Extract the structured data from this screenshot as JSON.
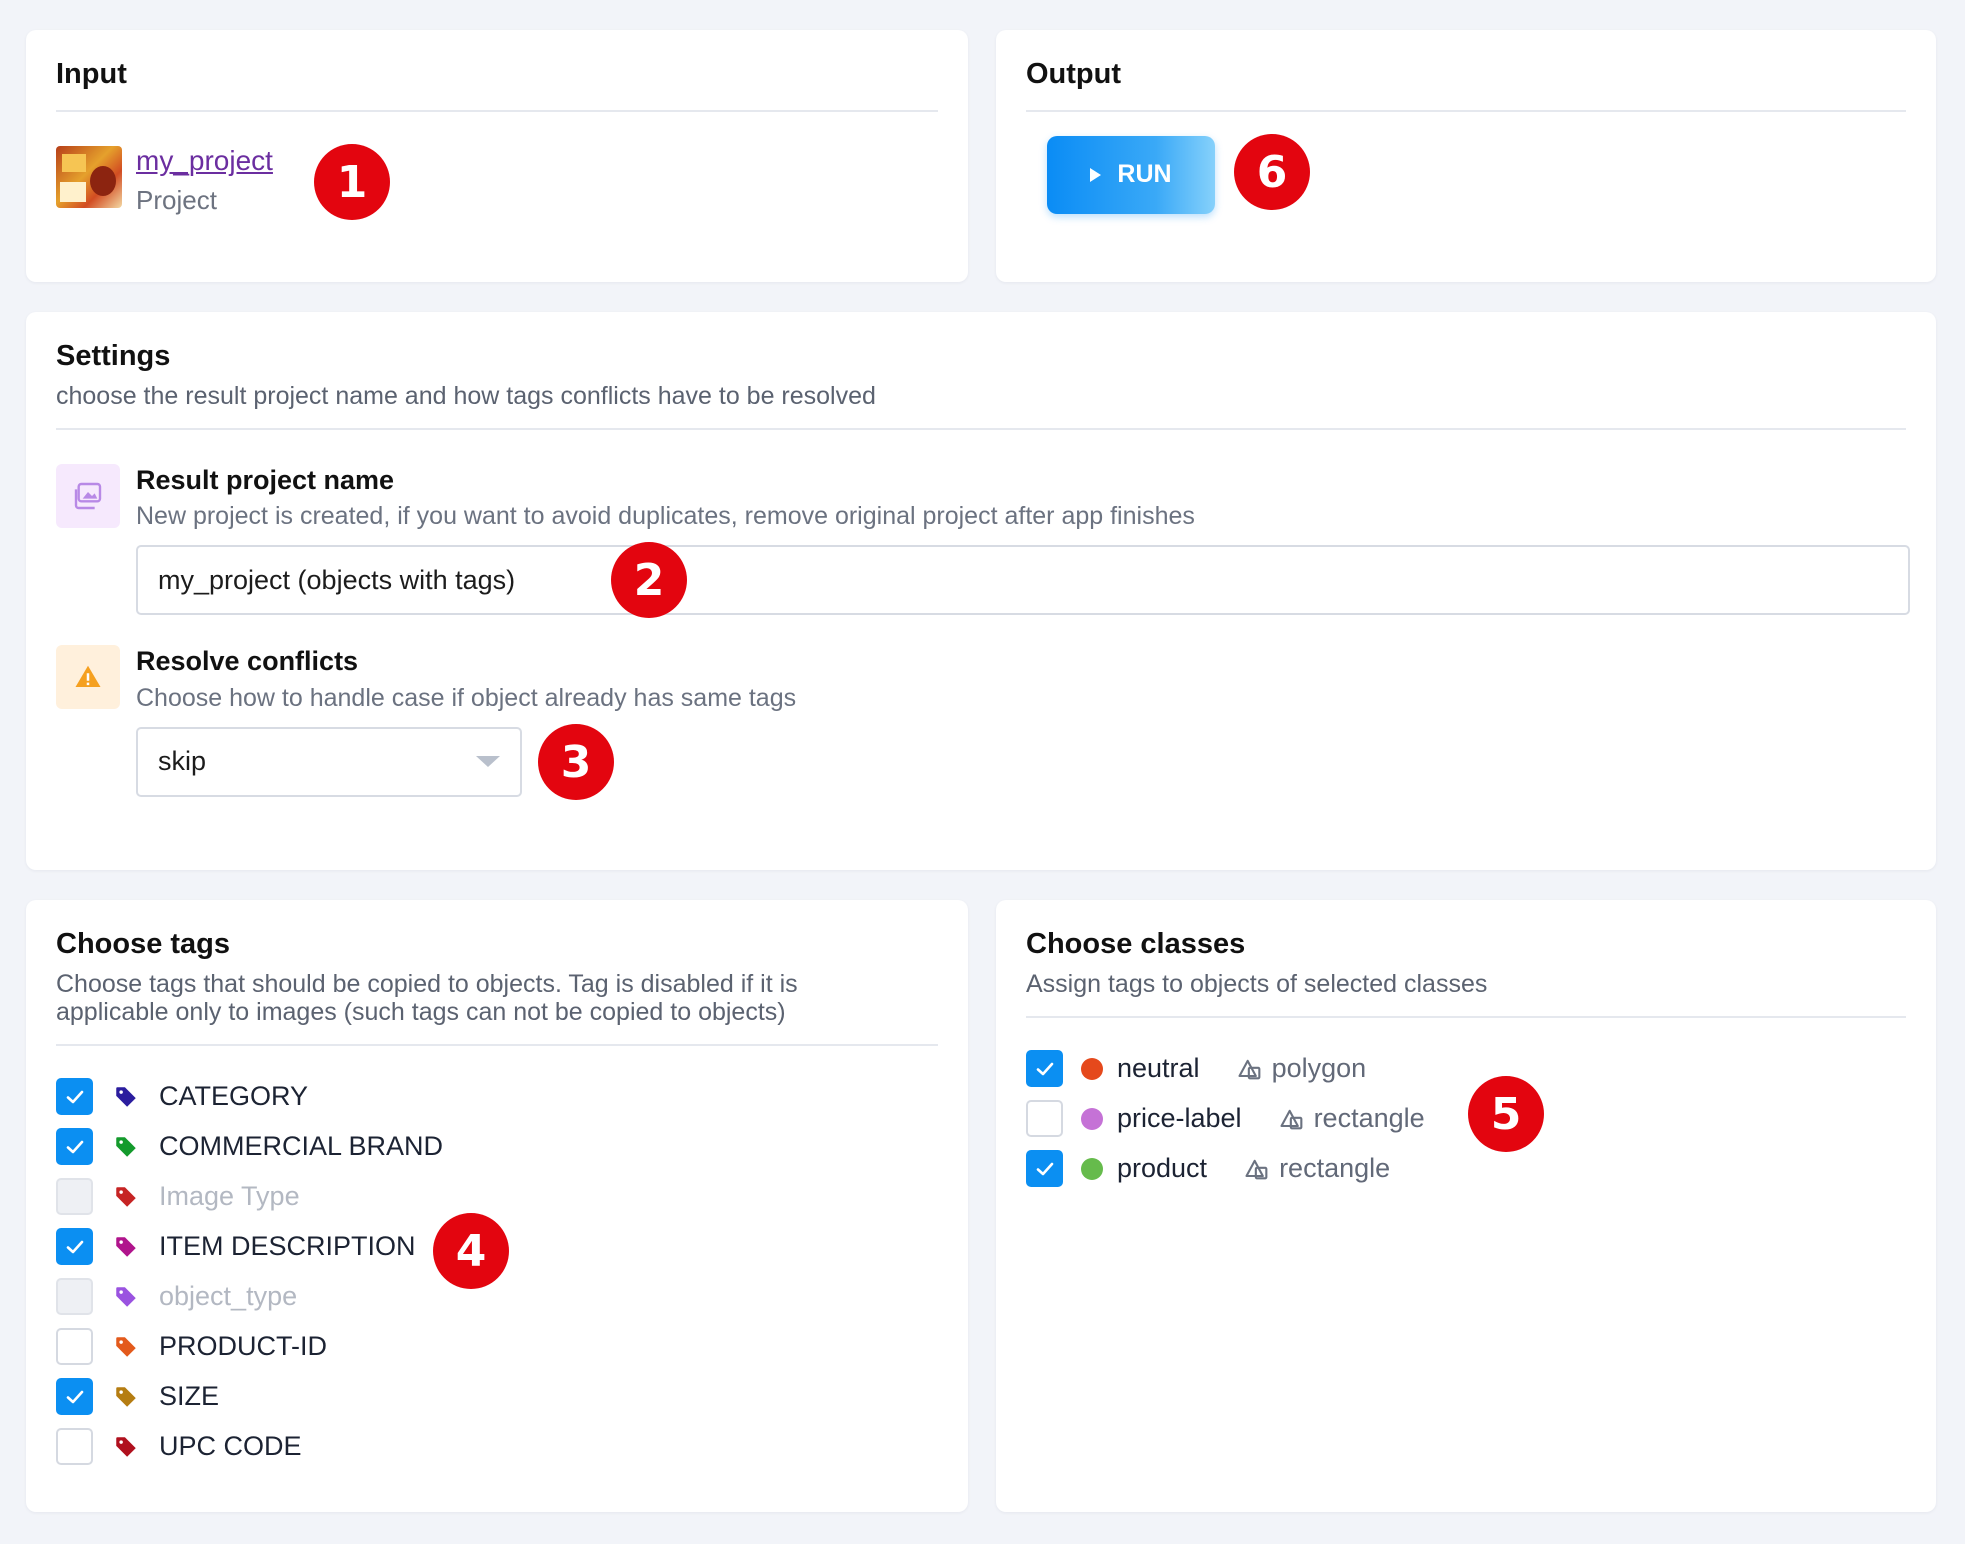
{
  "input": {
    "title": "Input",
    "project_name": "my_project",
    "project_type": "Project"
  },
  "output": {
    "title": "Output",
    "run_label": "RUN"
  },
  "settings": {
    "title": "Settings",
    "description": "choose the result project name and how tags conflicts have to be resolved",
    "result_name": {
      "title": "Result project name",
      "description": "New project is created, if you want to avoid duplicates, remove original project after app finishes",
      "value": "my_project (objects with tags)"
    },
    "conflicts": {
      "title": "Resolve conflicts",
      "description": "Choose how to handle case if object already has same tags",
      "selected": "skip"
    }
  },
  "tags": {
    "title": "Choose tags",
    "description": "Choose tags that should be copied to objects. Tag is disabled if it is applicable only to images (such tags can not be copied to objects)",
    "items": [
      {
        "label": "CATEGORY",
        "checked": true,
        "disabled": false,
        "color": "#2b1d9e"
      },
      {
        "label": "COMMERCIAL BRAND",
        "checked": true,
        "disabled": false,
        "color": "#149a2c"
      },
      {
        "label": "Image Type",
        "checked": false,
        "disabled": true,
        "color": "#c62424"
      },
      {
        "label": "ITEM DESCRIPTION",
        "checked": true,
        "disabled": false,
        "color": "#b0148c"
      },
      {
        "label": "object_type",
        "checked": false,
        "disabled": true,
        "color": "#9a53e0"
      },
      {
        "label": "PRODUCT-ID",
        "checked": false,
        "disabled": false,
        "color": "#e35a1c"
      },
      {
        "label": "SIZE",
        "checked": true,
        "disabled": false,
        "color": "#b57d12"
      },
      {
        "label": "UPC CODE",
        "checked": false,
        "disabled": false,
        "color": "#b0101e"
      }
    ]
  },
  "classes": {
    "title": "Choose classes",
    "description": "Assign tags to objects of selected classes",
    "items": [
      {
        "name": "neutral",
        "shape": "polygon",
        "checked": true,
        "color": "#e5491c"
      },
      {
        "name": "price-label",
        "shape": "rectangle",
        "checked": false,
        "color": "#c572d6"
      },
      {
        "name": "product",
        "shape": "rectangle",
        "checked": true,
        "color": "#66bb4c"
      }
    ]
  },
  "badges": [
    "1",
    "2",
    "3",
    "4",
    "5",
    "6"
  ],
  "colors": {
    "accent": "#0b8ff2",
    "badge": "#e3050f",
    "link": "#6b2ea0"
  }
}
